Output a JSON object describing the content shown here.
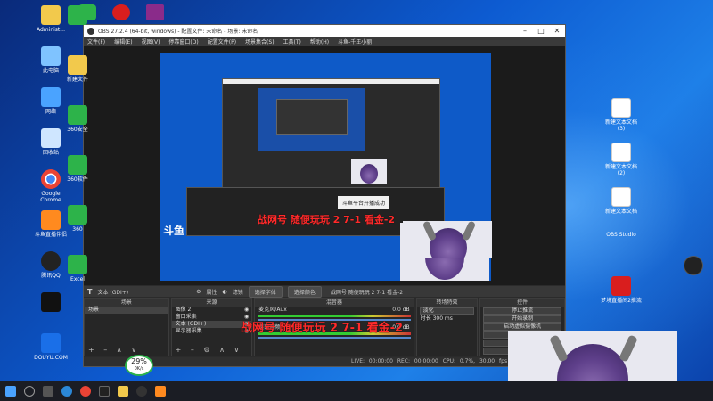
{
  "desktop": {
    "icons_left": [
      {
        "label": "Administ...",
        "kind": "folder"
      },
      {
        "label": "此电脑",
        "kind": "pc"
      },
      {
        "label": "网络",
        "kind": "net"
      },
      {
        "label": "回收站",
        "kind": "recycle"
      },
      {
        "label": "Google Chrome",
        "kind": "chrome"
      },
      {
        "label": "斗鱼直播伴侣",
        "kind": "app"
      },
      {
        "label": "腾讯QQ",
        "kind": "qq"
      },
      {
        "label": "",
        "kind": "tiktok"
      },
      {
        "label": "DOUYU.COM",
        "kind": "douyu"
      }
    ],
    "icons_col2": [
      {
        "label": "",
        "kind": "green"
      },
      {
        "label": "新建文件",
        "kind": "folder"
      },
      {
        "label": "360安全",
        "kind": "green"
      },
      {
        "label": "360软件",
        "kind": "green"
      },
      {
        "label": "360",
        "kind": "green"
      },
      {
        "label": "Excel",
        "kind": "green"
      }
    ],
    "icons_right": [
      {
        "label": "新建文本文档 (3)",
        "kind": "doc"
      },
      {
        "label": "新建文本文档 (2)",
        "kind": "doc"
      },
      {
        "label": "新建文本文档",
        "kind": "doc"
      },
      {
        "label": "OBS Studio",
        "kind": "obs"
      },
      {
        "label": "梦境直播间2推流",
        "kind": "red"
      }
    ],
    "top_icons": [
      "",
      "",
      "",
      ""
    ]
  },
  "obs": {
    "title": "OBS 27.2.4 (64-bit, windows) - 配置文件: 未命名 - 场景: 未命名",
    "menu": [
      "文件(F)",
      "编辑(E)",
      "视图(V)",
      "停靠窗口(D)",
      "配置文件(P)",
      "场景集合(S)",
      "工具(T)",
      "帮助(H)",
      "斗鱼-千王小丽"
    ],
    "toolbar": {
      "source_icon": "T",
      "source_name": "文本 (GDI+)",
      "properties": "属性",
      "filters": "滤镜",
      "select_file": "选择字体",
      "select_color": "选择颜色",
      "text_value": "战网号 随便玩玩 2 7-1 看金-2"
    },
    "docks": {
      "scenes": {
        "title": "场景",
        "items": [
          "场景"
        ]
      },
      "sources": {
        "title": "来源",
        "items": [
          "图像 2",
          "窗口采集",
          "文本 (GDI+)",
          "显示器采集"
        ]
      },
      "mixer": {
        "title": "混音器",
        "tracks": [
          {
            "name": "麦克风/Aux",
            "db": "0.0 dB"
          },
          {
            "name": "桌面音频",
            "db": "0.0 dB"
          }
        ]
      },
      "transitions": {
        "title": "转场特效",
        "type": "淡化",
        "duration_label": "时长",
        "duration": "300 ms"
      },
      "controls": {
        "title": "控件",
        "buttons": [
          "停止推流",
          "开始录制",
          "启动虚拟摄像机",
          "工作室模式",
          "设置",
          "退出"
        ]
      }
    },
    "status": {
      "live": "LIVE: 00:00:00",
      "rec": "REC: 00:00:00",
      "cpu": "CPU: 0.7%, 30.00 fps"
    }
  },
  "overlay_text": {
    "preview_red": "战网号 随便玩玩 2 7-1 看金-2",
    "desktop_red": "战网号 随便玩玩 2 7-1 看金-2",
    "notice": "斗鱼平台开播成功"
  },
  "tray": {
    "percent": "29%",
    "speed": "0K/s"
  },
  "colors": {
    "accent_red": "#ff2a2a",
    "obs_bg": "#2b2b2b",
    "desktop_blue": "#0d5bd1"
  }
}
